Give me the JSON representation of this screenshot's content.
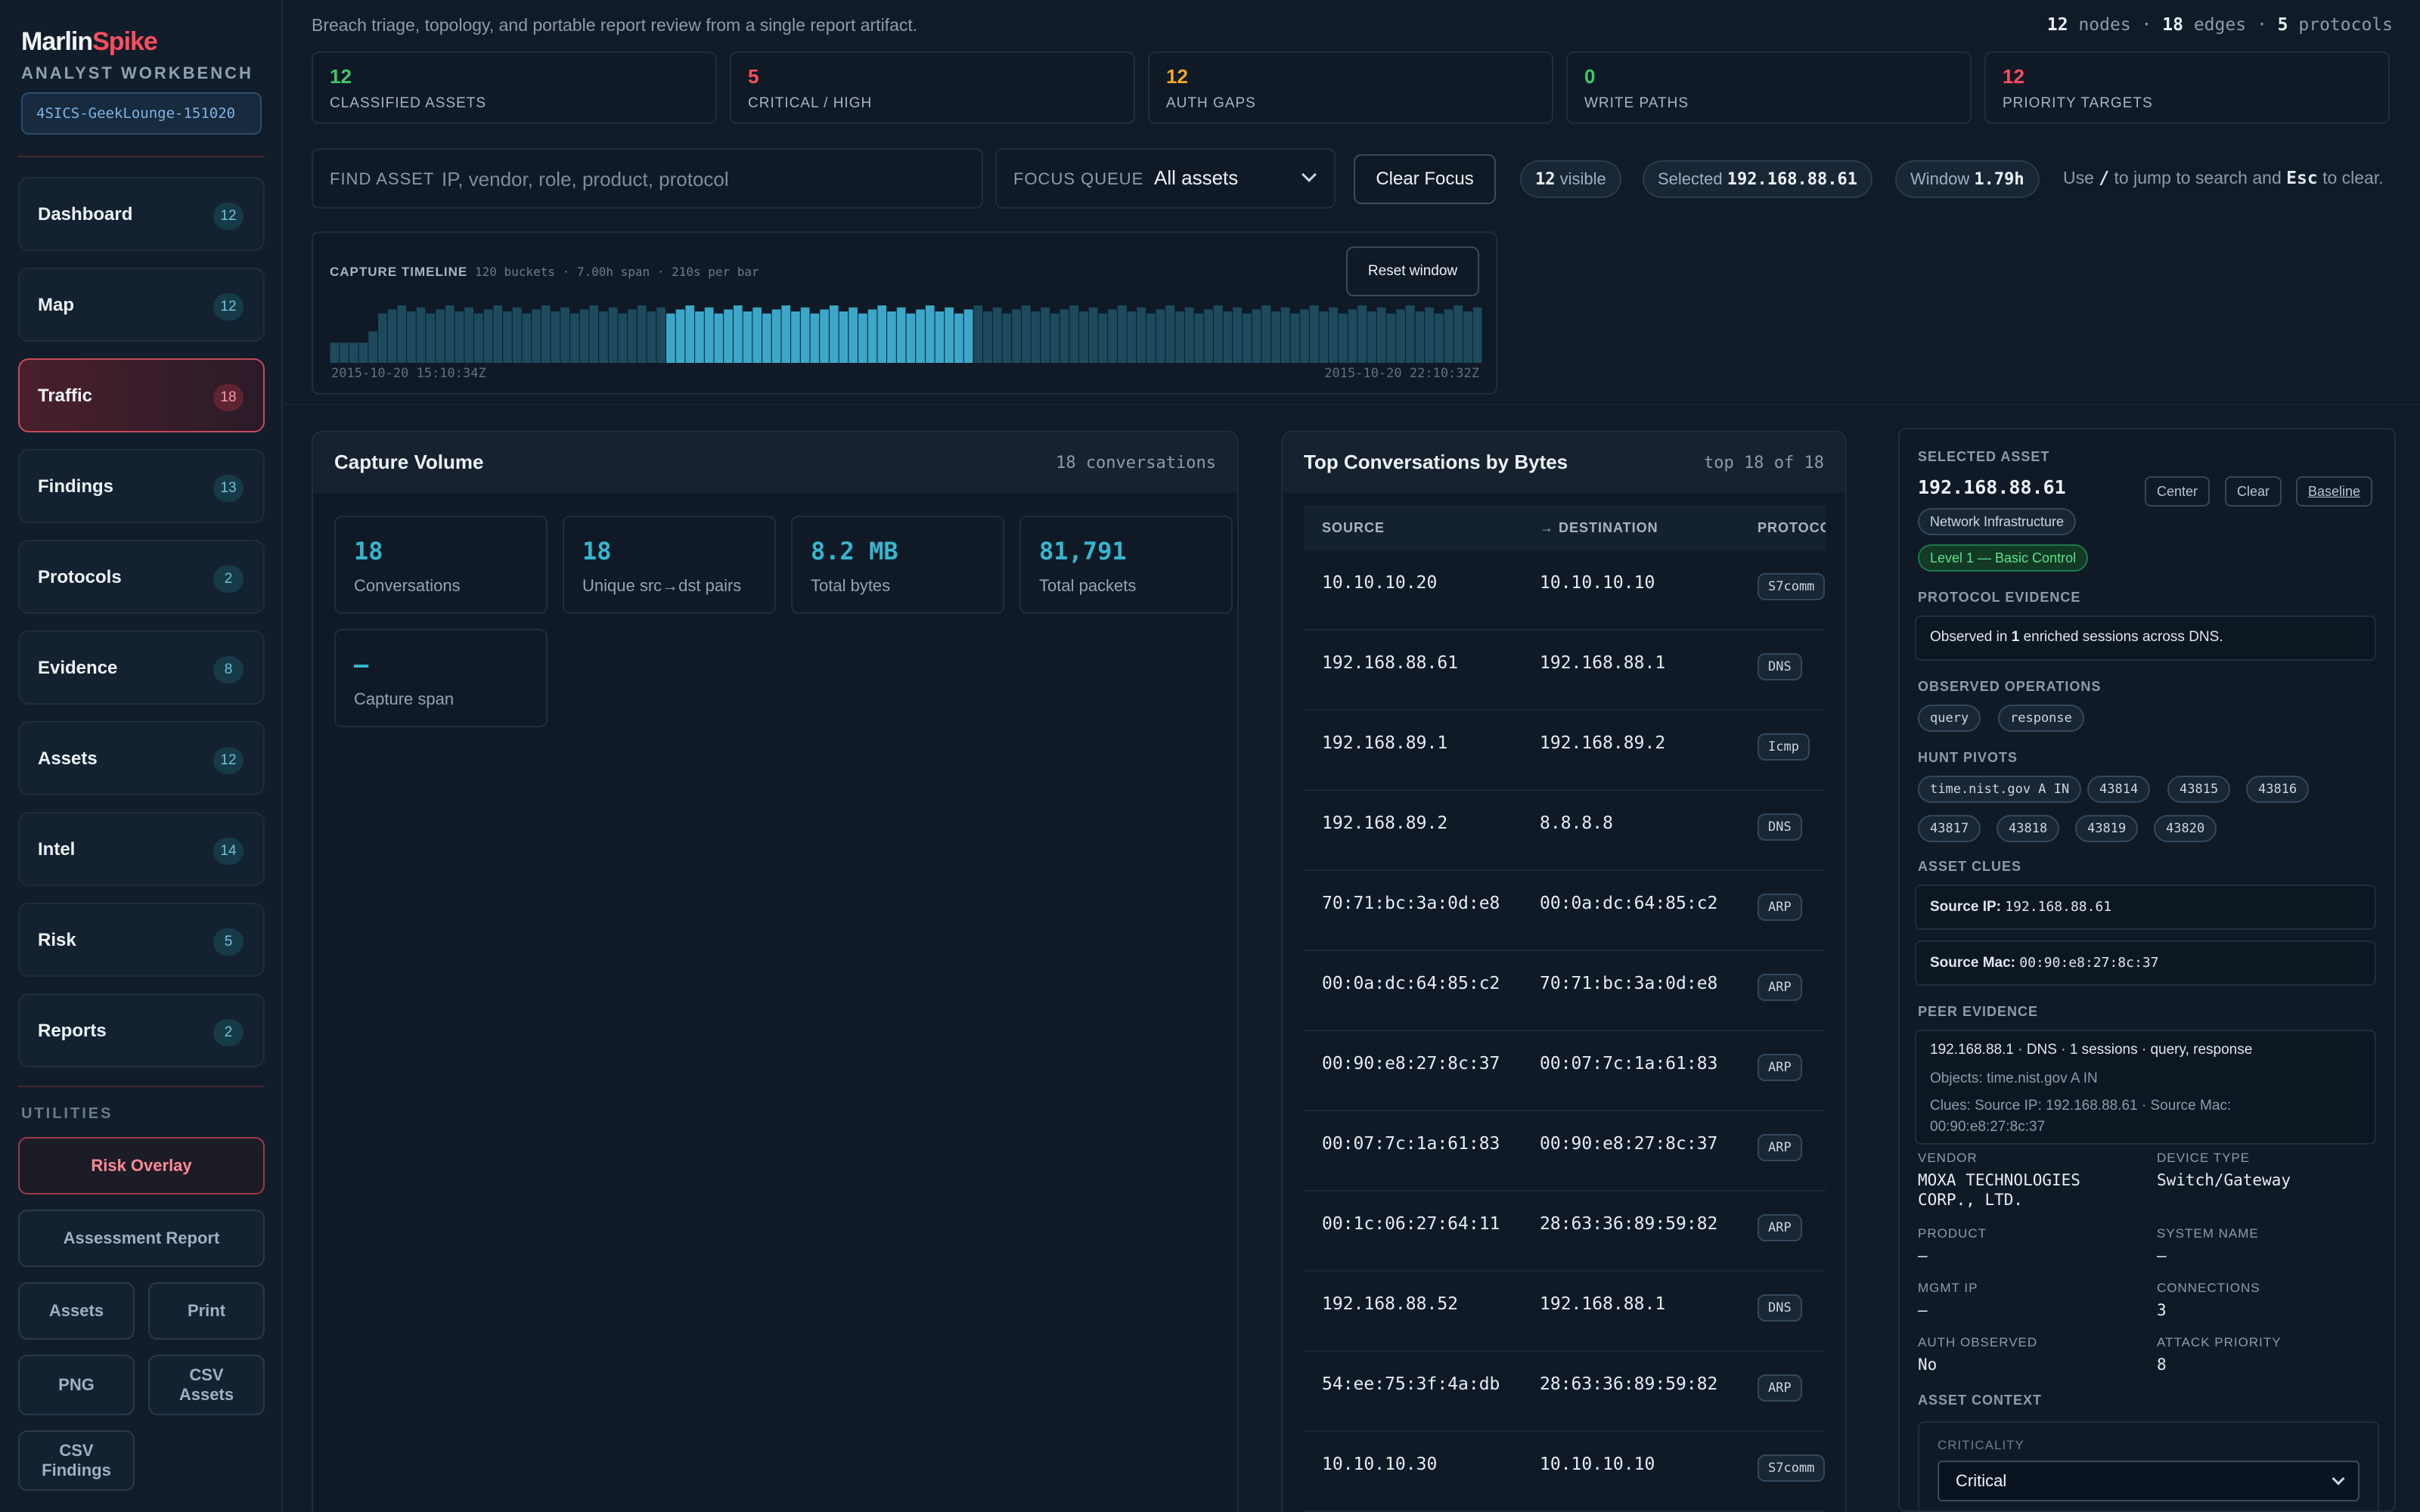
{
  "brand": {
    "part1": "Marlin",
    "part2": "Spike",
    "subtitle": "ANALYST WORKBENCH",
    "report_id": "4SICS-GeekLounge-151020"
  },
  "nav": [
    {
      "label": "Dashboard",
      "count": "12"
    },
    {
      "label": "Map",
      "count": "12"
    },
    {
      "label": "Traffic",
      "count": "18",
      "active": true
    },
    {
      "label": "Findings",
      "count": "13"
    },
    {
      "label": "Protocols",
      "count": "2"
    },
    {
      "label": "Evidence",
      "count": "8"
    },
    {
      "label": "Assets",
      "count": "12"
    },
    {
      "label": "Intel",
      "count": "14"
    },
    {
      "label": "Risk",
      "count": "5"
    },
    {
      "label": "Reports",
      "count": "2"
    }
  ],
  "utilities": {
    "heading": "UTILITIES",
    "risk_overlay": "Risk Overlay",
    "assessment_report": "Assessment Report",
    "assets": "Assets",
    "print": "Print",
    "png": "PNG",
    "csv_assets": "CSV Assets",
    "csv_findings": "CSV Findings"
  },
  "header": {
    "tagline": "Breach triage, topology, and portable report review from a single report artifact.",
    "nodes": "12",
    "nodes_label": "nodes",
    "edges": "18",
    "edges_label": "edges",
    "protocols": "5",
    "protocols_label": "protocols",
    "sep": "·"
  },
  "kpis": [
    {
      "value": "12",
      "label": "CLASSIFIED ASSETS",
      "color": "#3fc96a"
    },
    {
      "value": "5",
      "label": "CRITICAL / HIGH",
      "color": "#ff4d5e"
    },
    {
      "value": "12",
      "label": "AUTH GAPS",
      "color": "#f5a524"
    },
    {
      "value": "0",
      "label": "WRITE PATHS",
      "color": "#3fc96a"
    },
    {
      "value": "12",
      "label": "PRIORITY TARGETS",
      "color": "#ff4d5e"
    }
  ],
  "search": {
    "label": "FIND ASSET",
    "placeholder": "IP, vendor, role, product, protocol"
  },
  "focus": {
    "label": "FOCUS QUEUE",
    "value": "All assets"
  },
  "clear_focus": "Clear Focus",
  "pills": {
    "visible_value": "12",
    "visible_label": "visible",
    "selected_label": "Selected",
    "selected_value": "192.168.88.61",
    "window_label": "Window",
    "window_value": "1.79h"
  },
  "hint": {
    "pre": "Use",
    "key1": "/",
    "mid": "to jump to search and",
    "key2": "Esc",
    "post": "to clear."
  },
  "timeline": {
    "title": "CAPTURE TIMELINE",
    "subtitle": "120 buckets · 7.00h span · 210s per bar",
    "reset": "Reset window",
    "start": "2015-10-20 15:10:34Z",
    "end": "2015-10-20 22:10:32Z",
    "bucket_count": 120,
    "selected_range": [
      35,
      66
    ],
    "colors": {
      "bar": "#1d4b5d",
      "selected": "#3da7c9"
    }
  },
  "capture_volume": {
    "title": "Capture Volume",
    "right": "18 conversations",
    "stats": [
      {
        "value": "18",
        "label": "Conversations"
      },
      {
        "value": "18",
        "label": "Unique src→dst pairs"
      },
      {
        "value": "8.2 MB",
        "label": "Total bytes"
      },
      {
        "value": "81,791",
        "label": "Total packets"
      },
      {
        "value": "—",
        "label": "Capture span"
      }
    ]
  },
  "conversations": {
    "title": "Top Conversations by Bytes",
    "right": "top 18 of 18",
    "columns": [
      "SOURCE",
      "→ DESTINATION",
      "PROTOCO"
    ],
    "rows": [
      {
        "src": "10.10.10.20",
        "dst": "10.10.10.10",
        "proto": "S7comm"
      },
      {
        "src": "192.168.88.61",
        "dst": "192.168.88.1",
        "proto": "DNS"
      },
      {
        "src": "192.168.89.1",
        "dst": "192.168.89.2",
        "proto": "Icmp"
      },
      {
        "src": "192.168.89.2",
        "dst": "8.8.8.8",
        "proto": "DNS"
      },
      {
        "src": "70:71:bc:3a:0d:e8",
        "dst": "00:0a:dc:64:85:c2",
        "proto": "ARP"
      },
      {
        "src": "00:0a:dc:64:85:c2",
        "dst": "70:71:bc:3a:0d:e8",
        "proto": "ARP"
      },
      {
        "src": "00:90:e8:27:8c:37",
        "dst": "00:07:7c:1a:61:83",
        "proto": "ARP"
      },
      {
        "src": "00:07:7c:1a:61:83",
        "dst": "00:90:e8:27:8c:37",
        "proto": "ARP"
      },
      {
        "src": "00:1c:06:27:64:11",
        "dst": "28:63:36:89:59:82",
        "proto": "ARP"
      },
      {
        "src": "192.168.88.52",
        "dst": "192.168.88.1",
        "proto": "DNS"
      },
      {
        "src": "54:ee:75:3f:4a:db",
        "dst": "28:63:36:89:59:82",
        "proto": "ARP"
      },
      {
        "src": "10.10.10.30",
        "dst": "10.10.10.10",
        "proto": "S7comm"
      }
    ]
  },
  "detail": {
    "heading": "SELECTED ASSET",
    "ip": "192.168.88.61",
    "buttons": {
      "center": "Center",
      "clear": "Clear",
      "baseline": "Baseline"
    },
    "role_chip": "Network Infrastructure",
    "level_chip": "Level 1 — Basic Control",
    "protocol_evidence_h": "PROTOCOL EVIDENCE",
    "protocol_evidence": {
      "pre": "Observed in",
      "count": "1",
      "mid": "enriched sessions across",
      "proto": "DNS."
    },
    "observed_ops_h": "OBSERVED OPERATIONS",
    "observed_ops": [
      "query",
      "response"
    ],
    "hunt_pivots_h": "HUNT PIVOTS",
    "hunt_pivots": [
      "time.nist.gov A IN",
      "43814",
      "43815",
      "43816",
      "43817",
      "43818",
      "43819",
      "43820"
    ],
    "asset_clues_h": "ASSET CLUES",
    "clue1_label": "Source IP:",
    "clue1_value": "192.168.88.61",
    "clue2_label": "Source Mac:",
    "clue2_value": "00:90:e8:27:8c:37",
    "peer_evidence_h": "PEER EVIDENCE",
    "peer_line1": "192.168.88.1 · DNS · 1 sessions · query, response",
    "peer_line2": "Objects: time.nist.gov A IN",
    "peer_line3": "Clues: Source IP: 192.168.88.61 · Source Mac:",
    "peer_line4": "00:90:e8:27:8c:37",
    "fields": {
      "vendor_k": "VENDOR",
      "vendor_v1": "MOXA TECHNOLOGIES",
      "vendor_v2": "CORP., LTD.",
      "device_type_k": "DEVICE TYPE",
      "device_type_v": "Switch/Gateway",
      "product_k": "PRODUCT",
      "product_v": "—",
      "system_name_k": "SYSTEM NAME",
      "system_name_v": "—",
      "mgmt_ip_k": "MGMT IP",
      "mgmt_ip_v": "—",
      "connections_k": "CONNECTIONS",
      "connections_v": "3",
      "auth_observed_k": "AUTH OBSERVED",
      "auth_observed_v": "No",
      "attack_priority_k": "ATTACK PRIORITY",
      "attack_priority_v": "8"
    },
    "asset_context_h": "ASSET CONTEXT",
    "criticality_label": "CRITICALITY",
    "criticality_value": "Critical"
  }
}
